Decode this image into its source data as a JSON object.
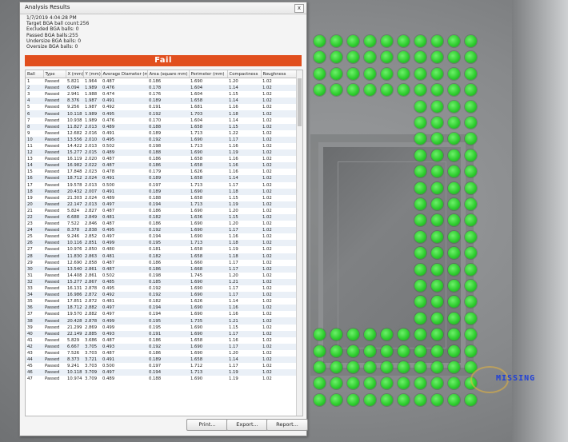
{
  "dialog": {
    "title": "Analysis Results",
    "close_label": "x",
    "summary": [
      "1/7/2019 4:04:28 PM",
      "Target BGA ball count:256",
      "Excluded BGA balls: 0",
      "Passed BGA balls:255",
      "Undersize BGA balls: 0",
      "Oversize BGA balls: 0"
    ],
    "result": "Fail",
    "columns": [
      "Ball",
      "Type",
      "X (mm)",
      "Y (mm)",
      "Average Diameter (mm)",
      "Area (square mm)",
      "Perimeter (mm)",
      "Compactness",
      "Roughness"
    ],
    "rows": [
      [
        "1",
        "Passed",
        "5.821",
        "1.964",
        "0.487",
        "0.186",
        "1.690",
        "1.20",
        "1.02"
      ],
      [
        "2",
        "Passed",
        "6.094",
        "1.989",
        "0.476",
        "0.178",
        "1.604",
        "1.14",
        "1.02"
      ],
      [
        "3",
        "Passed",
        "2.941",
        "1.988",
        "0.474",
        "0.176",
        "1.604",
        "1.15",
        "1.02"
      ],
      [
        "4",
        "Passed",
        "8.376",
        "1.987",
        "0.491",
        "0.189",
        "1.658",
        "1.14",
        "1.02"
      ],
      [
        "5",
        "Passed",
        "9.256",
        "1.987",
        "0.492",
        "0.191",
        "1.681",
        "1.16",
        "1.02"
      ],
      [
        "6",
        "Passed",
        "10.118",
        "1.989",
        "0.495",
        "0.192",
        "1.703",
        "1.18",
        "1.02"
      ],
      [
        "7",
        "Passed",
        "10.938",
        "1.989",
        "0.476",
        "0.170",
        "1.604",
        "1.14",
        "1.02"
      ],
      [
        "8",
        "Passed",
        "11.827",
        "2.013",
        "0.489",
        "0.188",
        "1.658",
        "1.15",
        "1.02"
      ],
      [
        "9",
        "Passed",
        "12.682",
        "2.016",
        "0.491",
        "0.189",
        "1.713",
        "1.22",
        "1.02"
      ],
      [
        "10",
        "Passed",
        "13.556",
        "2.010",
        "0.495",
        "0.192",
        "1.690",
        "1.17",
        "1.02"
      ],
      [
        "11",
        "Passed",
        "14.422",
        "2.013",
        "0.502",
        "0.198",
        "1.713",
        "1.16",
        "1.02"
      ],
      [
        "12",
        "Passed",
        "15.277",
        "2.015",
        "0.489",
        "0.188",
        "1.690",
        "1.19",
        "1.02"
      ],
      [
        "13",
        "Passed",
        "16.119",
        "2.020",
        "0.487",
        "0.186",
        "1.658",
        "1.16",
        "1.02"
      ],
      [
        "14",
        "Passed",
        "16.982",
        "2.022",
        "0.487",
        "0.186",
        "1.658",
        "1.16",
        "1.02"
      ],
      [
        "15",
        "Passed",
        "17.848",
        "2.023",
        "0.478",
        "0.179",
        "1.626",
        "1.16",
        "1.02"
      ],
      [
        "16",
        "Passed",
        "18.712",
        "2.024",
        "0.491",
        "0.189",
        "1.658",
        "1.14",
        "1.02"
      ],
      [
        "17",
        "Passed",
        "19.578",
        "2.013",
        "0.500",
        "0.197",
        "1.713",
        "1.17",
        "1.02"
      ],
      [
        "18",
        "Passed",
        "20.432",
        "2.007",
        "0.491",
        "0.189",
        "1.690",
        "1.18",
        "1.02"
      ],
      [
        "19",
        "Passed",
        "21.303",
        "2.024",
        "0.489",
        "0.188",
        "1.658",
        "1.15",
        "1.02"
      ],
      [
        "20",
        "Passed",
        "22.147",
        "2.013",
        "0.497",
        "0.194",
        "1.713",
        "1.19",
        "1.02"
      ],
      [
        "21",
        "Passed",
        "5.824",
        "2.827",
        "0.487",
        "0.186",
        "1.690",
        "1.20",
        "1.02"
      ],
      [
        "22",
        "Passed",
        "6.688",
        "2.849",
        "0.481",
        "0.182",
        "1.636",
        "1.15",
        "1.02"
      ],
      [
        "23",
        "Passed",
        "7.522",
        "2.846",
        "0.487",
        "0.186",
        "1.690",
        "1.20",
        "1.02"
      ],
      [
        "24",
        "Passed",
        "8.378",
        "2.838",
        "0.495",
        "0.192",
        "1.690",
        "1.17",
        "1.02"
      ],
      [
        "25",
        "Passed",
        "9.246",
        "2.852",
        "0.497",
        "0.194",
        "1.690",
        "1.16",
        "1.02"
      ],
      [
        "26",
        "Passed",
        "10.116",
        "2.851",
        "0.499",
        "0.195",
        "1.713",
        "1.18",
        "1.02"
      ],
      [
        "27",
        "Passed",
        "10.976",
        "2.850",
        "0.480",
        "0.181",
        "1.658",
        "1.19",
        "1.02"
      ],
      [
        "28",
        "Passed",
        "11.830",
        "2.863",
        "0.481",
        "0.182",
        "1.658",
        "1.18",
        "1.02"
      ],
      [
        "29",
        "Passed",
        "12.690",
        "2.858",
        "0.487",
        "0.186",
        "1.660",
        "1.17",
        "1.02"
      ],
      [
        "30",
        "Passed",
        "13.540",
        "2.861",
        "0.487",
        "0.186",
        "1.668",
        "1.17",
        "1.02"
      ],
      [
        "31",
        "Passed",
        "14.408",
        "2.861",
        "0.502",
        "0.198",
        "1.745",
        "1.20",
        "1.02"
      ],
      [
        "32",
        "Passed",
        "15.277",
        "2.867",
        "0.485",
        "0.185",
        "1.690",
        "1.21",
        "1.02"
      ],
      [
        "33",
        "Passed",
        "16.131",
        "2.878",
        "0.495",
        "0.192",
        "1.690",
        "1.17",
        "1.02"
      ],
      [
        "34",
        "Passed",
        "16.986",
        "2.872",
        "0.492",
        "0.192",
        "1.690",
        "1.17",
        "1.02"
      ],
      [
        "35",
        "Passed",
        "17.851",
        "2.872",
        "0.481",
        "0.182",
        "1.626",
        "1.14",
        "1.02"
      ],
      [
        "36",
        "Passed",
        "18.712",
        "2.882",
        "0.497",
        "0.194",
        "1.690",
        "1.16",
        "1.02"
      ],
      [
        "37",
        "Passed",
        "19.570",
        "2.882",
        "0.497",
        "0.194",
        "1.690",
        "1.16",
        "1.02"
      ],
      [
        "38",
        "Passed",
        "20.428",
        "2.878",
        "0.499",
        "0.195",
        "1.735",
        "1.21",
        "1.02"
      ],
      [
        "39",
        "Passed",
        "21.299",
        "2.869",
        "0.499",
        "0.195",
        "1.690",
        "1.15",
        "1.02"
      ],
      [
        "40",
        "Passed",
        "22.149",
        "2.885",
        "0.493",
        "0.191",
        "1.690",
        "1.17",
        "1.02"
      ],
      [
        "41",
        "Passed",
        "5.829",
        "3.686",
        "0.487",
        "0.186",
        "1.658",
        "1.16",
        "1.02"
      ],
      [
        "42",
        "Passed",
        "6.667",
        "3.705",
        "0.493",
        "0.192",
        "1.690",
        "1.17",
        "1.02"
      ],
      [
        "43",
        "Passed",
        "7.526",
        "3.703",
        "0.487",
        "0.186",
        "1.690",
        "1.20",
        "1.02"
      ],
      [
        "44",
        "Passed",
        "8.373",
        "3.721",
        "0.491",
        "0.189",
        "1.658",
        "1.14",
        "1.02"
      ],
      [
        "45",
        "Passed",
        "9.241",
        "3.703",
        "0.500",
        "0.197",
        "1.712",
        "1.17",
        "1.02"
      ],
      [
        "46",
        "Passed",
        "10.118",
        "3.709",
        "0.497",
        "0.194",
        "1.713",
        "1.19",
        "1.02"
      ],
      [
        "47",
        "Passed",
        "10.974",
        "3.709",
        "0.489",
        "0.188",
        "1.690",
        "1.19",
        "1.02"
      ]
    ],
    "buttons": {
      "print": "Print...",
      "export": "Export...",
      "report": "Report..."
    }
  },
  "image": {
    "missing_label": "MISSING"
  }
}
